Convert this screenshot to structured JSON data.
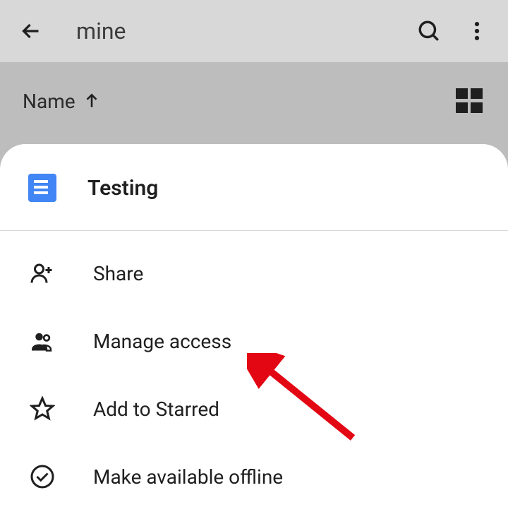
{
  "header": {
    "search_query": "mine"
  },
  "sort": {
    "label": "Name"
  },
  "sheet": {
    "file_title": "Testing",
    "items": [
      {
        "label": "Share"
      },
      {
        "label": "Manage access"
      },
      {
        "label": "Add to Starred"
      },
      {
        "label": "Make available offline"
      }
    ]
  }
}
